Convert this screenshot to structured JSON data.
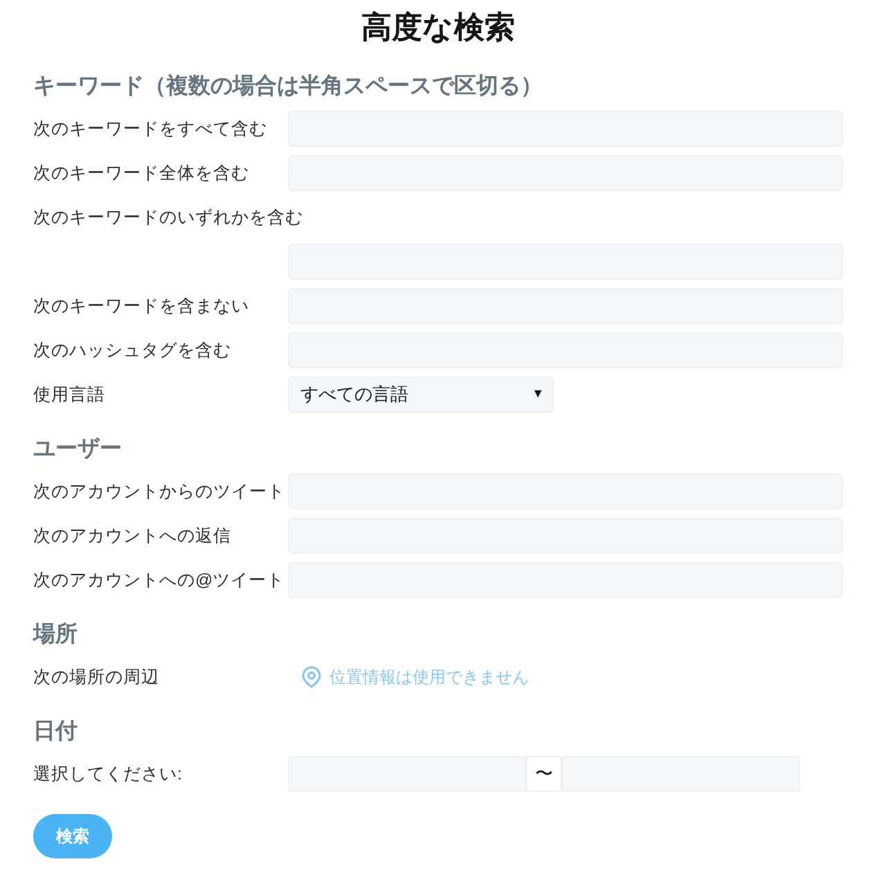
{
  "title": "高度な検索",
  "sections": [
    {
      "heading": "キーワード（複数の場合は半角スペースで区切る）",
      "fields": [
        {
          "kind": "text",
          "label": "次のキーワードをすべて含む",
          "stacked": false
        },
        {
          "kind": "text",
          "label": "次のキーワード全体を含む",
          "stacked": false
        },
        {
          "kind": "text",
          "label": "次のキーワードのいずれかを含む",
          "stacked": true
        },
        {
          "kind": "text",
          "label": "次のキーワードを含まない",
          "stacked": false
        },
        {
          "kind": "text",
          "label": "次のハッシュタグを含む",
          "stacked": false
        },
        {
          "kind": "select",
          "label": "使用言語",
          "value": "すべての言語",
          "caret": "▼"
        }
      ]
    },
    {
      "heading": "ユーザー",
      "fields": [
        {
          "kind": "text",
          "label": "次のアカウントからのツイート",
          "stacked": false
        },
        {
          "kind": "text",
          "label": "次のアカウントへの返信",
          "stacked": false
        },
        {
          "kind": "text",
          "label": "次のアカウントへの@ツイート",
          "stacked": false
        }
      ]
    },
    {
      "heading": "場所",
      "fields": [
        {
          "kind": "location",
          "label": "次の場所の周辺",
          "value": "位置情報は使用できません"
        }
      ]
    },
    {
      "heading": "日付",
      "fields": [
        {
          "kind": "daterange",
          "label": "選択してください:",
          "separator": "〜"
        }
      ]
    }
  ],
  "button": "検索"
}
